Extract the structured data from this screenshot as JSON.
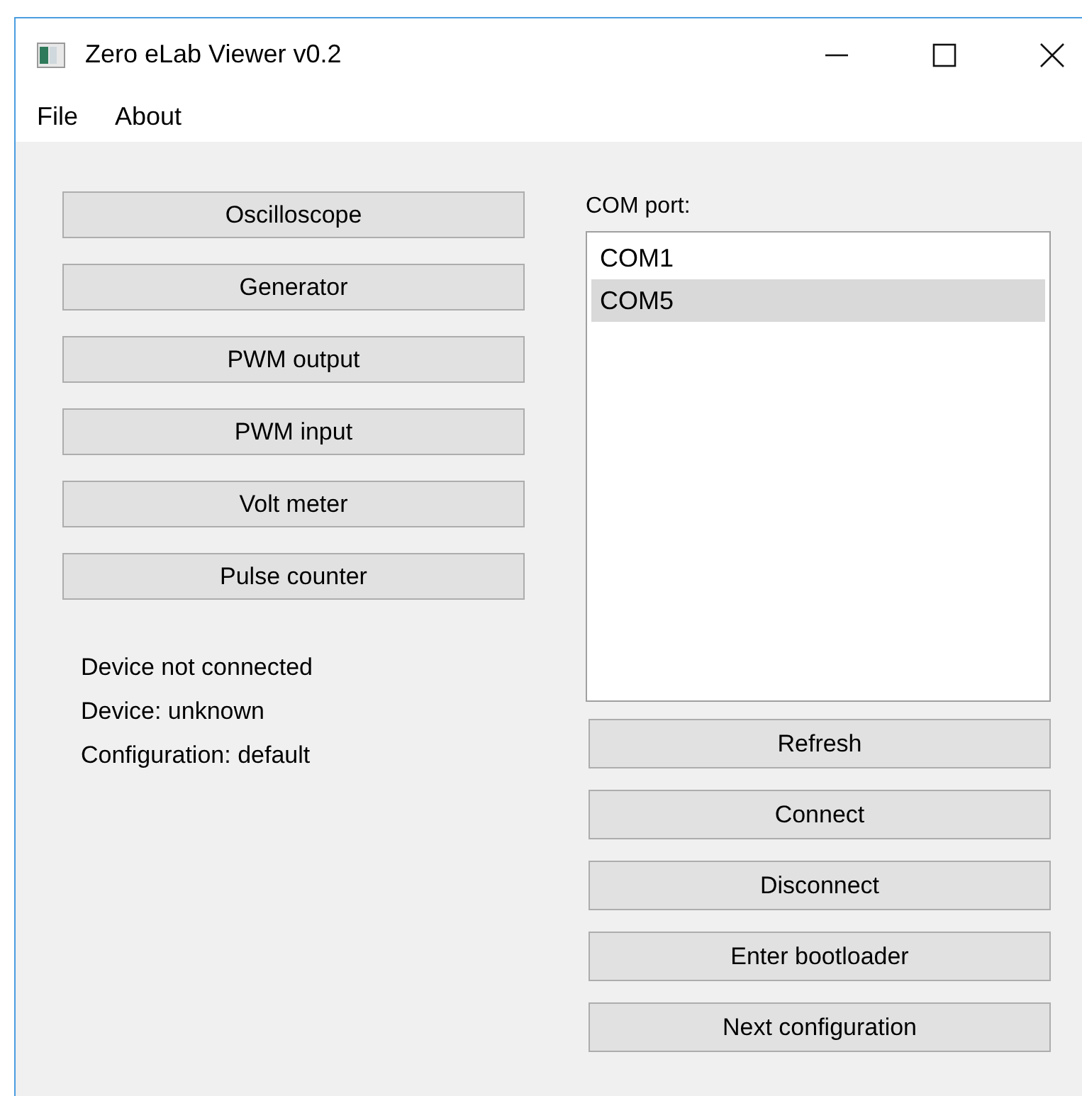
{
  "window": {
    "title": "Zero eLab Viewer v0.2"
  },
  "menu": [
    "File",
    "About"
  ],
  "tool_buttons": [
    "Oscilloscope",
    "Generator",
    "PWM output",
    "PWM input",
    "Volt meter",
    "Pulse counter"
  ],
  "status": [
    "Device not connected",
    "Device: unknown",
    "Configuration: default"
  ],
  "com_port": {
    "label": "COM port:",
    "ports": [
      {
        "name": "COM1",
        "selected": false
      },
      {
        "name": "COM5",
        "selected": true
      }
    ]
  },
  "action_buttons": [
    "Refresh",
    "Connect",
    "Disconnect",
    "Enter bootloader",
    "Next configuration"
  ]
}
